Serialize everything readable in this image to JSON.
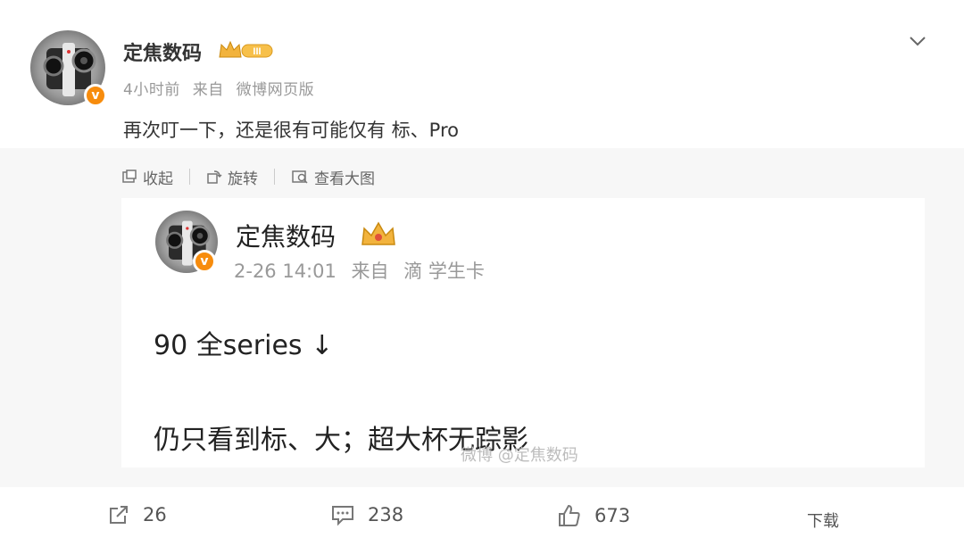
{
  "post": {
    "username": "定焦数码",
    "time": "4小时前",
    "source_prefix": "来自",
    "source": "微博网页版",
    "content": "再次叮一下，还是很有可能仅有 标、Pro"
  },
  "toolbar": {
    "collapse_label": "收起",
    "rotate_label": "旋转",
    "view_large_label": "查看大图"
  },
  "quoted": {
    "username": "定焦数码",
    "time": "2-26 14:01",
    "source_prefix": "来自",
    "source": "滴 学生卡",
    "line1": "90 全series ↓",
    "line2": "仍只看到标、大；超大杯无踪影",
    "watermark": "微博 @定焦数码"
  },
  "footer": {
    "repost_count": "26",
    "comment_count": "238",
    "like_count": "673",
    "download_label": "下载"
  },
  "colors": {
    "verified_badge": "#f78c0d",
    "crown": "#f2b33d"
  }
}
